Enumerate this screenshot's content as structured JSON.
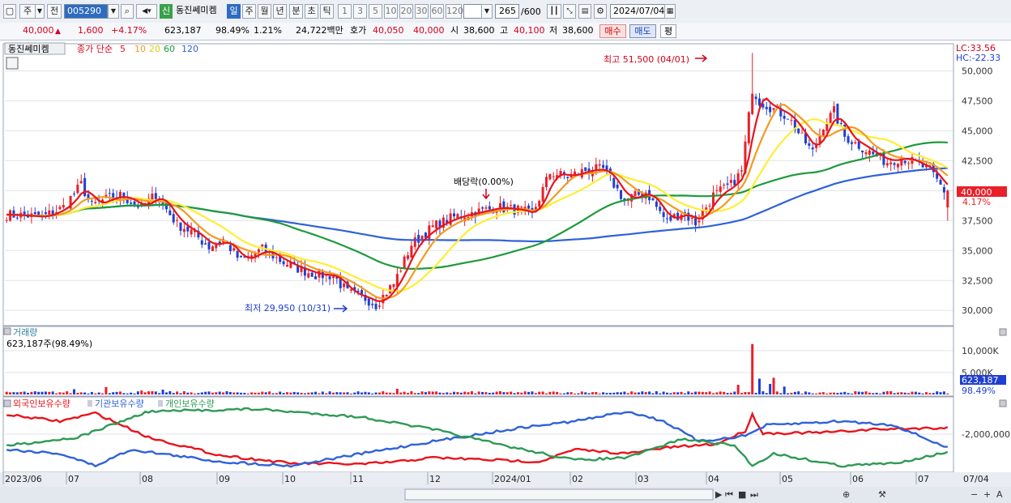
{
  "toolbar": {
    "market_type": "주",
    "scope": "전",
    "stock_code": "005290",
    "credit_badge": "신",
    "stock_name": "동진쎄미켐",
    "periods": [
      "일",
      "주",
      "월",
      "년",
      "분",
      "초",
      "틱"
    ],
    "selected_period": "일",
    "intervals": [
      "1",
      "3",
      "5",
      "10",
      "20",
      "30",
      "60",
      "120"
    ],
    "count_value": "265",
    "count_total": "/600",
    "date": "2024/07/04"
  },
  "quote": {
    "price": "40,000",
    "change": "1,600",
    "change_pct": "+4.17%",
    "volume": "623,187",
    "volume_ratio": "98.49%",
    "turnover": "1.21%",
    "amount": "24,722백만",
    "ask_label": "호가",
    "ask": "40,050",
    "bid": "40,000",
    "open_label": "시",
    "open": "38,600",
    "high_label": "고",
    "high": "40,100",
    "low_label": "저",
    "low": "38,600",
    "buy_label": "매수",
    "sell_label": "매도",
    "eval_label": "평"
  },
  "colors": {
    "up": "#e8202a",
    "down": "#1f3fd0",
    "ma5": "#e8141c",
    "ma10": "#f39a1e",
    "ma20": "#ffee33",
    "ma60": "#1e9a3a",
    "ma120": "#2f62d8",
    "foreign": "#e8141c",
    "institution": "#2f62d8",
    "individual": "#2e9a55"
  },
  "chart_data": [
    {
      "type": "candlestick",
      "title": "동진쎄미켐",
      "legend": {
        "label": "종가 단순",
        "periods": [
          "5",
          "10",
          "20",
          "60",
          "120"
        ]
      },
      "ylim": [
        29000,
        52000
      ],
      "y_ticks": [
        "30,000",
        "32,500",
        "35,000",
        "37,500",
        "40,000",
        "42,500",
        "45,000",
        "47,500",
        "50,000"
      ],
      "x_ticks": [
        "2023/06",
        "07",
        "08",
        "09",
        "10",
        "11",
        "12",
        "2024/01",
        "02",
        "03",
        "04",
        "05",
        "06",
        "07",
        "07/04"
      ],
      "top_right": {
        "lc": "LC:33.56",
        "hc": "HC:-22.33"
      },
      "last_price_label": "40,000",
      "last_change_label": "4.17%",
      "annotations": {
        "high": "최고 51,500 (04/01)",
        "low": "최저 29,950 (10/31)",
        "dividend": "배당락(0.00%)"
      },
      "close_path": [
        [
          0,
          38000
        ],
        [
          10,
          37800
        ],
        [
          16,
          38600
        ],
        [
          21,
          40500
        ],
        [
          24,
          38700
        ],
        [
          27,
          39200
        ],
        [
          32,
          39600
        ],
        [
          38,
          38600
        ],
        [
          42,
          39700
        ],
        [
          48,
          37200
        ],
        [
          52,
          36600
        ],
        [
          57,
          35300
        ],
        [
          61,
          35900
        ],
        [
          66,
          34100
        ],
        [
          72,
          35100
        ],
        [
          78,
          34000
        ],
        [
          82,
          33500
        ],
        [
          87,
          33000
        ],
        [
          92,
          32900
        ],
        [
          96,
          31500
        ],
        [
          101,
          31000
        ],
        [
          104,
          30500
        ],
        [
          109,
          32200
        ],
        [
          114,
          35500
        ],
        [
          120,
          37000
        ],
        [
          126,
          37800
        ],
        [
          132,
          38200
        ],
        [
          138,
          38600
        ],
        [
          144,
          38400
        ],
        [
          148,
          38000
        ],
        [
          153,
          41500
        ],
        [
          158,
          41200
        ],
        [
          163,
          41700
        ],
        [
          168,
          41800
        ],
        [
          174,
          39200
        ],
        [
          180,
          39900
        ],
        [
          186,
          37400
        ],
        [
          190,
          38200
        ],
        [
          194,
          37300
        ],
        [
          199,
          39600
        ],
        [
          204,
          40500
        ],
        [
          207,
          41600
        ],
        [
          210,
          48500
        ],
        [
          212,
          47500
        ],
        [
          216,
          46800
        ],
        [
          220,
          46200
        ],
        [
          224,
          44400
        ],
        [
          227,
          43200
        ],
        [
          230,
          45500
        ],
        [
          233,
          46600
        ],
        [
          236,
          44500
        ],
        [
          240,
          43800
        ],
        [
          244,
          43000
        ],
        [
          248,
          42400
        ],
        [
          252,
          42800
        ],
        [
          256,
          42300
        ],
        [
          260,
          41700
        ],
        [
          264,
          40000
        ]
      ]
    },
    {
      "type": "bar",
      "title": "거래량",
      "info": "623,187주(98.49%)",
      "y_ticks": [
        "10,000K",
        "5,000K"
      ],
      "last_value_label": "623,187",
      "last_ratio_label": "98.49%",
      "spikes": [
        [
          19,
          1200000
        ],
        [
          28,
          1700000
        ],
        [
          38,
          900000
        ],
        [
          44,
          1100000
        ],
        [
          110,
          1300000
        ],
        [
          206,
          2200000
        ],
        [
          210,
          11500000
        ],
        [
          212,
          3600000
        ],
        [
          215,
          2400000
        ],
        [
          216,
          3800000
        ],
        [
          219,
          1800000
        ]
      ]
    },
    {
      "type": "line",
      "series": [
        {
          "name": "외국인보유수량",
          "color_key": "foreign"
        },
        {
          "name": "기관보유수량",
          "color_key": "institution"
        },
        {
          "name": "개인보유수량",
          "color_key": "individual"
        }
      ],
      "y_ticks": [
        "-2,000,000"
      ]
    }
  ]
}
